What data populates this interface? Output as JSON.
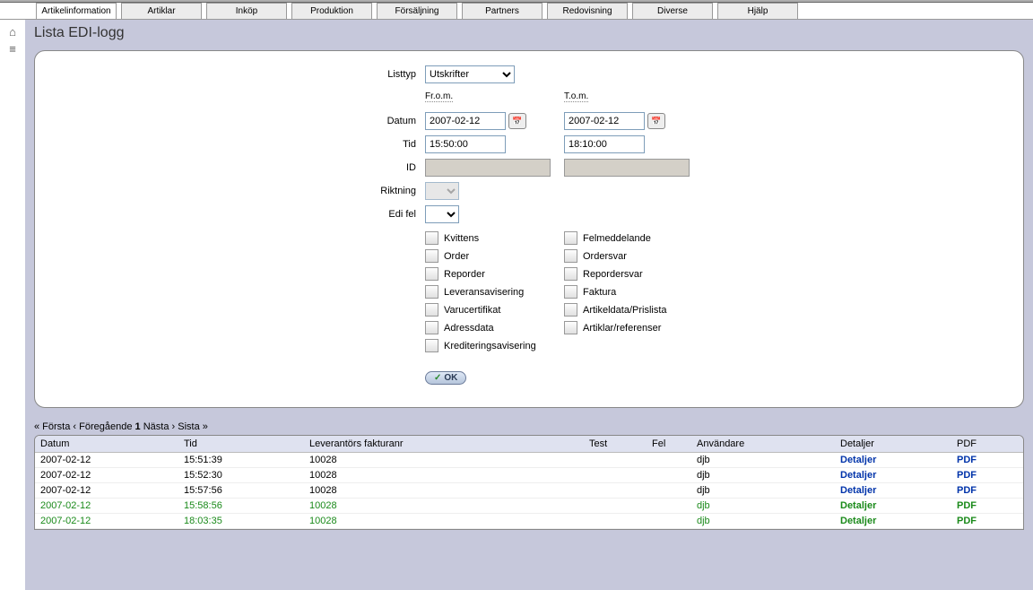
{
  "menu": [
    "Artikelinformation",
    "Artiklar",
    "Inköp",
    "Produktion",
    "Försäljning",
    "Partners",
    "Redovisning",
    "Diverse",
    "Hjälp"
  ],
  "page_title": "Lista EDI-logg",
  "form": {
    "labels": {
      "listtyp": "Listtyp",
      "datum": "Datum",
      "tid": "Tid",
      "id": "ID",
      "riktning": "Riktning",
      "edifel": "Edi fel",
      "from": "Fr.o.m.",
      "tom": "T.o.m."
    },
    "listtyp_value": "Utskrifter",
    "datum_from": "2007-02-12",
    "datum_tom": "2007-02-12",
    "tid_from": "15:50:00",
    "tid_tom": "18:10:00",
    "checkboxes_col1": [
      "Kvittens",
      "Order",
      "Reporder",
      "Leveransavisering",
      "Varucertifikat",
      "Adressdata",
      "Krediteringsavisering"
    ],
    "checkboxes_col2": [
      "Felmeddelande",
      "Ordersvar",
      "Repordersvar",
      "Faktura",
      "Artikeldata/Prislista",
      "Artiklar/referenser"
    ],
    "ok": "OK"
  },
  "pager": {
    "first": "« Första",
    "prev": "‹ Föregående",
    "current": "1",
    "next": "Nästa ›",
    "last": "Sista »"
  },
  "table": {
    "headers": [
      "Datum",
      "Tid",
      "Leverantörs fakturanr",
      "Test",
      "Fel",
      "Användare",
      "Detaljer",
      "PDF"
    ],
    "rows": [
      {
        "datum": "2007-02-12",
        "tid": "15:51:39",
        "faknr": "10028",
        "test": "",
        "fel": "",
        "user": "djb",
        "detaljer": "Detaljer",
        "pdf": "PDF",
        "green": false
      },
      {
        "datum": "2007-02-12",
        "tid": "15:52:30",
        "faknr": "10028",
        "test": "",
        "fel": "",
        "user": "djb",
        "detaljer": "Detaljer",
        "pdf": "PDF",
        "green": false
      },
      {
        "datum": "2007-02-12",
        "tid": "15:57:56",
        "faknr": "10028",
        "test": "",
        "fel": "",
        "user": "djb",
        "detaljer": "Detaljer",
        "pdf": "PDF",
        "green": false
      },
      {
        "datum": "2007-02-12",
        "tid": "15:58:56",
        "faknr": "10028",
        "test": "",
        "fel": "",
        "user": "djb",
        "detaljer": "Detaljer",
        "pdf": "PDF",
        "green": true
      },
      {
        "datum": "2007-02-12",
        "tid": "18:03:35",
        "faknr": "10028",
        "test": "",
        "fel": "",
        "user": "djb",
        "detaljer": "Detaljer",
        "pdf": "PDF",
        "green": true
      }
    ]
  }
}
